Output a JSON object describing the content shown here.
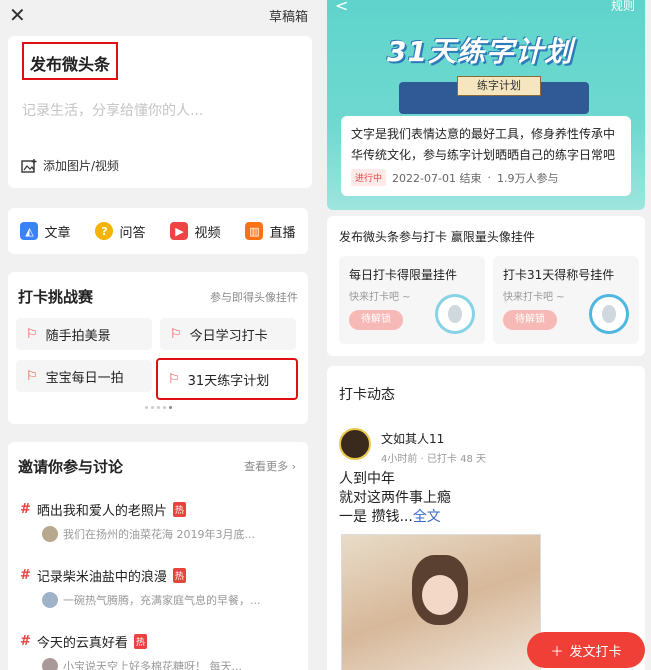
{
  "left": {
    "drafts": "草稿箱",
    "compose_title": "发布微头条",
    "placeholder": "记录生活，分享给懂你的人...",
    "add_media": "添加图片/视频",
    "types": [
      {
        "label": "文章",
        "icon": "article-icon",
        "color": "#3b82f6"
      },
      {
        "label": "问答",
        "icon": "qa-icon",
        "color": "#f5b400"
      },
      {
        "label": "视频",
        "icon": "video-icon",
        "color": "#ef4444"
      },
      {
        "label": "直播",
        "icon": "live-icon",
        "color": "#f97316"
      }
    ],
    "challenge": {
      "title": "打卡挑战赛",
      "side": "参与即得头像挂件",
      "items": [
        "随手拍美景",
        "今日学习打卡",
        "宝宝每日一拍",
        "31天练字计划"
      ]
    },
    "discuss": {
      "title": "邀请你参与讨论",
      "more": "查看更多",
      "topics": [
        {
          "title": "晒出我和爱人的老照片",
          "hot": "热",
          "sub": "我们在扬州的油菜花海  2019年3月底..."
        },
        {
          "title": "记录柴米油盐中的浪漫",
          "hot": "热",
          "sub": "一碗热气腾腾，充满家庭气息的早餐，..."
        },
        {
          "title": "今天的云真好看",
          "hot": "热",
          "sub": "小宝说天空上好多棉花糖呀！      每天..."
        }
      ]
    }
  },
  "right": {
    "back": "<",
    "rules": "规则",
    "banner_title": "31天练字计划",
    "scroll_text": "练字计划",
    "desc": "文字是我们表情达意的最好工具，修身养性传承中华传统文化，参与练字计划晒晒自己的练字日常吧",
    "status": "进行中",
    "end": "2022-07-01 结束",
    "dot": "·",
    "participants": "1.9万人参与",
    "rewards_title": "发布微头条参与打卡 赢限量头像挂件",
    "rewards": [
      {
        "title": "每日打卡得限量挂件",
        "sub": "快来打卡吧 ~",
        "btn": "待解锁"
      },
      {
        "title": "打卡31天得称号挂件",
        "sub": "快来打卡吧 ~",
        "btn": "待解锁"
      }
    ],
    "feed_title": "打卡动态",
    "post": {
      "name": "文如其人11",
      "time": "4小时前",
      "dot": "·",
      "checked": "已打卡 48 天",
      "line1": "人到中年",
      "line2": "就对这两件事上瘾",
      "line3": "一是 攒钱...",
      "more": "全文"
    },
    "fab": "发文打卡"
  }
}
